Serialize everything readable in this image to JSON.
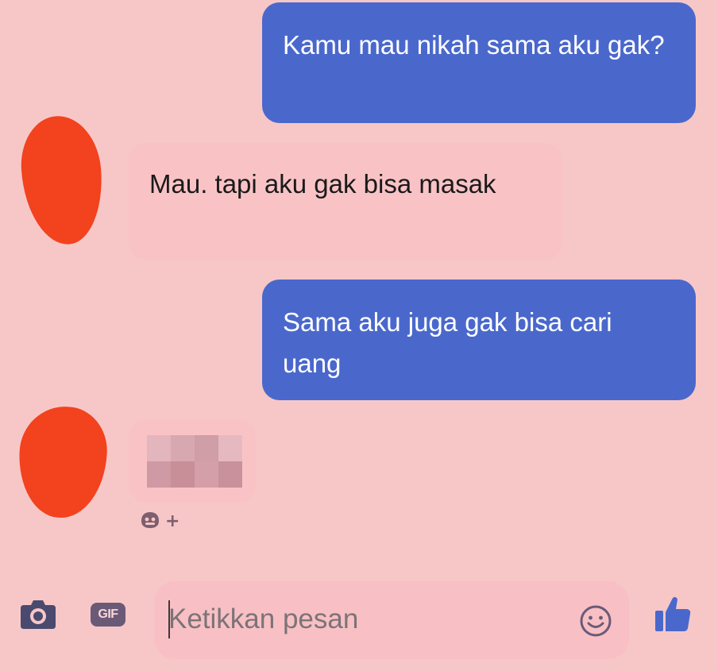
{
  "messages": [
    {
      "direction": "outgoing",
      "text": "Kamu mau nikah sama aku gak?"
    },
    {
      "direction": "incoming",
      "text": "Mau. tapi aku gak bisa masak"
    },
    {
      "direction": "outgoing",
      "text": "Sama aku juga gak bisa cari uang"
    }
  ],
  "reaction": {
    "add_label": "+"
  },
  "composer": {
    "gif_label": "GIF",
    "input_placeholder": "Ketikkan pesan",
    "input_value": ""
  },
  "colors": {
    "background": "#f7c7c7",
    "outgoing_bubble": "#4a68cc",
    "incoming_bubble": "#f9c3c6",
    "avatar_redaction": "#f2421e",
    "icon": "#6a5a78"
  },
  "icons": {
    "camera": "camera-icon",
    "gif": "gif-icon",
    "emoji": "smiley-icon",
    "like": "thumbs-up-icon",
    "reaction": "add-reaction-icon"
  }
}
